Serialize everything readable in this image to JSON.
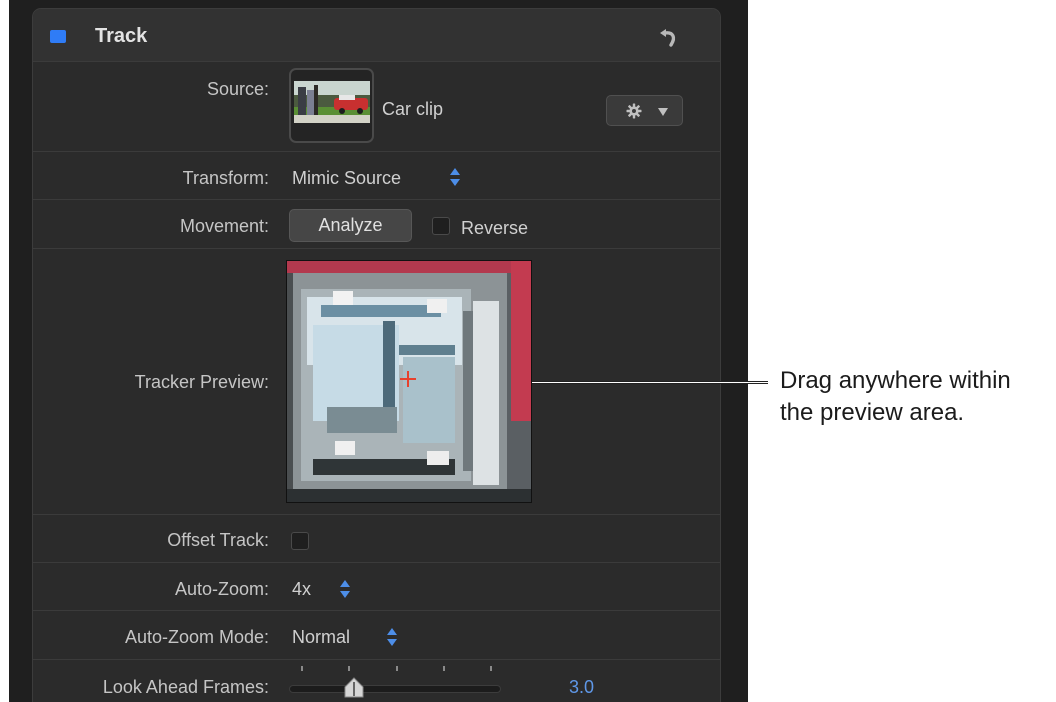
{
  "header": {
    "title": "Track",
    "accent_color": "#2f7cf6",
    "reset_icon": "reset-arrow-icon"
  },
  "rows": {
    "source": {
      "label": "Source:",
      "clip_name": "Car clip",
      "menu_icon": "gear-icon"
    },
    "transform": {
      "label": "Transform:",
      "value": "Mimic Source"
    },
    "movement": {
      "label": "Movement:",
      "button": "Analyze",
      "checkbox_label": "Reverse",
      "reverse_checked": false
    },
    "tracker_preview": {
      "label": "Tracker Preview:",
      "crosshair_icon": "crosshair-icon"
    },
    "offset_track": {
      "label": "Offset Track:",
      "checked": false
    },
    "auto_zoom": {
      "label": "Auto-Zoom:",
      "value": "4x"
    },
    "auto_zoom_mode": {
      "label": "Auto-Zoom Mode:",
      "value": "Normal"
    },
    "look_ahead": {
      "label": "Look Ahead Frames:",
      "value": "3.0",
      "slider_value": 3.0,
      "slider_range": [
        1,
        10
      ]
    }
  },
  "callout": {
    "line1": "Drag anywhere within",
    "line2": "the preview area."
  },
  "colors": {
    "panel": "#2b2b2b",
    "value_blue": "#5f98e8",
    "stepper_blue": "#4d8ee8"
  }
}
